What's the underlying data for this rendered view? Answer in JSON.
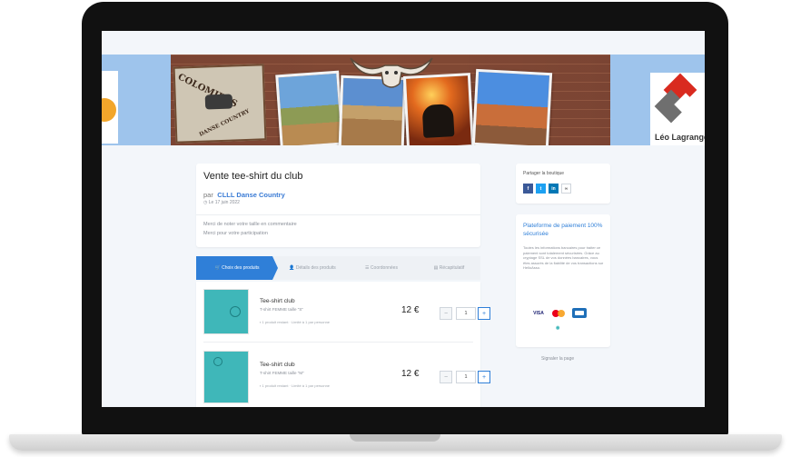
{
  "banner": {
    "sign_line1": "COLOMIERS",
    "sign_line2": "DANSE COUNTRY",
    "partner_logo_text": "Léo Lagrange"
  },
  "campaign": {
    "title": "Vente tee-shirt du club",
    "by_prefix": "par",
    "organization": "CLLL Danse Country",
    "date": "Le 17 juin 2022",
    "message_line1": "Merci de noter votre taille en commentaire",
    "message_line2": "Merci pour votre participation"
  },
  "steps": [
    {
      "label": "Choix des produits",
      "icon": "cart-icon"
    },
    {
      "label": "Détails des produits",
      "icon": "user-icon"
    },
    {
      "label": "Coordonnées",
      "icon": "list-icon"
    },
    {
      "label": "Récapitulatif",
      "icon": "document-icon"
    }
  ],
  "products": [
    {
      "name": "Tee-shirt club",
      "description": "T-shirt FEMME taille \"S\"",
      "note": "1 produit restant · Limité à 1 par personne",
      "price": "12 €",
      "quantity": "1"
    },
    {
      "name": "Tee-shirt club",
      "description": "T-shirt FEMME taille \"M\"",
      "note": "1 produit restant · Limité à 1 par personne",
      "price": "12 €",
      "quantity": "1"
    }
  ],
  "sidebar": {
    "share_title": "Partager la boutique",
    "share_buttons": [
      {
        "label": "f",
        "icon": "facebook-icon",
        "color": "#3b5998"
      },
      {
        "label": "t",
        "icon": "twitter-icon",
        "color": "#1da1f2"
      },
      {
        "label": "in",
        "icon": "linkedin-icon",
        "color": "#0077b5"
      },
      {
        "label": "🔗",
        "icon": "link-icon",
        "color": "#ffffff"
      }
    ],
    "payment_title": "Plateforme de paiement 100% sécurisée",
    "payment_text": "Toutes les informations bancaires pour traiter ce paiement sont totalement sécurisées. Grâce au cryptage SSL de vos données bancaires, vous êtes assurés de la fiabilité de vos transactions sur HelloAsso.",
    "payment_cards": [
      "VISA",
      "",
      ""
    ],
    "report_link": "Signaler la page"
  },
  "colors": {
    "accent": "#2f7fd8",
    "banner_sky": "#9ec4ec",
    "page_bg": "#f3f6fa",
    "product_teal": "#3fb7b9"
  }
}
